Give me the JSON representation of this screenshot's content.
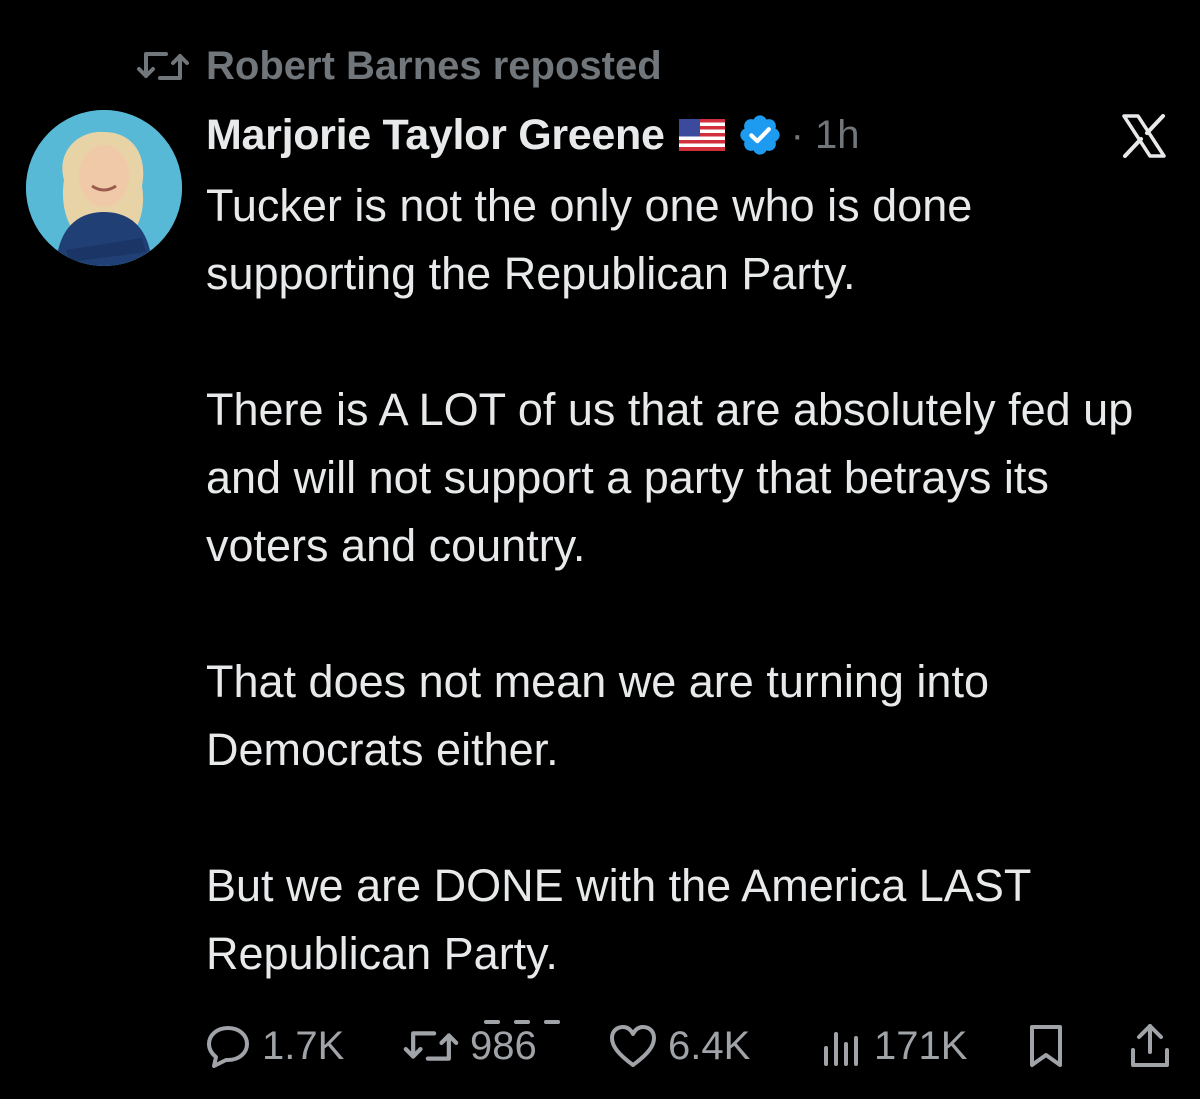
{
  "repost": {
    "text": "Robert Barnes reposted",
    "icon": "repost-icon"
  },
  "author": {
    "display_name": "Marjorie Taylor Greene",
    "flag_icon": "us-flag-icon",
    "verified_icon": "verified-badge-icon",
    "timestamp": "· 1h"
  },
  "brand_icon": "x-logo-icon",
  "tweet": {
    "paragraphs": [
      "Tucker is not the only one who is done supporting the Republican Party.",
      "There is A LOT of us that are absolutely fed up and will not support a party that betrays its voters and country.",
      "That does not mean we are turning into Democrats either.",
      "But we are DONE with the America LAST Republican Party."
    ]
  },
  "actions": {
    "replies": "1.7K",
    "reposts": "986",
    "likes": "6.4K",
    "views": "171K"
  },
  "colors": {
    "background": "#000000",
    "text": "#e7e9ea",
    "muted": "#71767b",
    "verified": "#1d9bf0",
    "avatar_bg": "#58b9d6"
  }
}
